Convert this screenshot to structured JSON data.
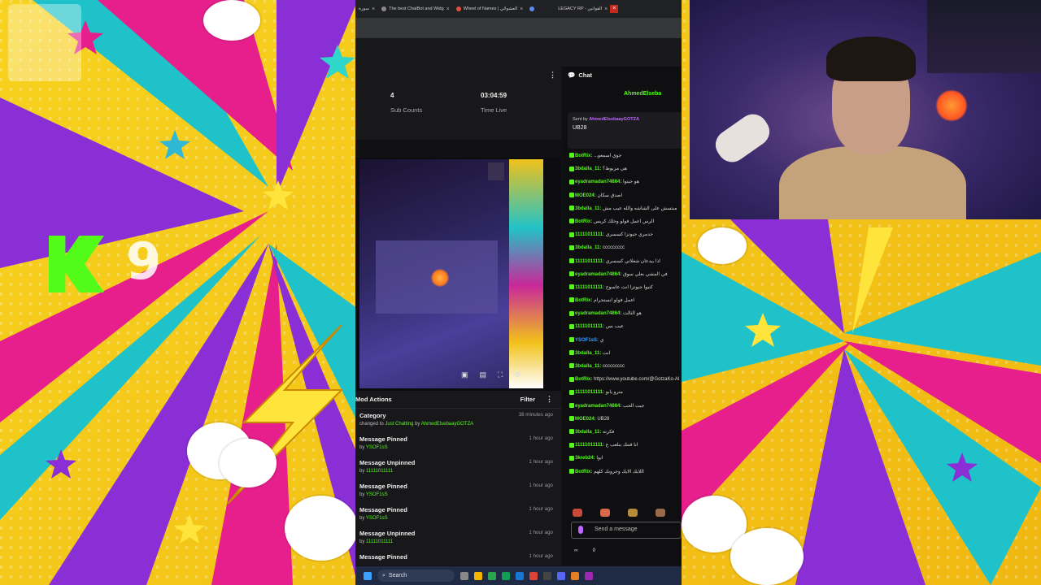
{
  "browser": {
    "tabs": [
      {
        "label": "سورة"
      },
      {
        "label": "The best ChatBot and Widg"
      },
      {
        "label": "Wheel of Names | العشوائي"
      },
      {
        "label": ""
      },
      {
        "label": "LEGACY RP - القوانين"
      }
    ],
    "close_glyph": "×"
  },
  "overlay": {
    "kick_count": "9"
  },
  "dashboard": {
    "stats": [
      {
        "value": "4",
        "label": "Sub Counts"
      },
      {
        "value": "03:04:59",
        "label": "Time Live"
      }
    ],
    "kebab_glyph": "⋮"
  },
  "player": {
    "controls": [
      "▣",
      "▤",
      "⛶",
      "⚙"
    ]
  },
  "mod_actions": {
    "title": "Mod Actions",
    "filter_label": "Filter",
    "items": [
      {
        "title": "Category",
        "by_prefix": "changed to",
        "target": "Just Chatting",
        "by_word": "by",
        "user": "AhmedElsebaayGOTZA",
        "time": "38 minutes ago"
      },
      {
        "title": "Message Pinned",
        "by_prefix": "by",
        "target": "",
        "by_word": "",
        "user": "YSOF1sS",
        "time": "1 hour ago"
      },
      {
        "title": "Message Unpinned",
        "by_prefix": "by",
        "target": "",
        "by_word": "",
        "user": "11111011111",
        "time": "1 hour ago"
      },
      {
        "title": "Message Pinned",
        "by_prefix": "by",
        "target": "",
        "by_word": "",
        "user": "YSOF1sS",
        "time": "1 hour ago"
      },
      {
        "title": "Message Pinned",
        "by_prefix": "by",
        "target": "",
        "by_word": "",
        "user": "YSOF1sS",
        "time": "1 hour ago"
      },
      {
        "title": "Message Unpinned",
        "by_prefix": "by",
        "target": "",
        "by_word": "",
        "user": "11111011111",
        "time": "1 hour ago"
      },
      {
        "title": "Message Pinned",
        "by_prefix": "",
        "target": "",
        "by_word": "",
        "user": "",
        "time": "1 hour ago"
      }
    ]
  },
  "chat": {
    "title": "Chat",
    "user": "AhmedElseba",
    "pinned": {
      "sent_by": "Sent by",
      "sender": "AhmedElsebaayGOTZA",
      "message": "UB28"
    },
    "messages": [
      {
        "name": "BotRix:",
        "color": "#53fc18",
        "text": "...جوي اسمعو"
      },
      {
        "name": "3bdalla_11:",
        "color": "#53fc18",
        "text": "هي مزبوط؟"
      },
      {
        "name": "eyadramadan74864:",
        "color": "#53fc18",
        "text": "هو جيتوا"
      },
      {
        "name": "MOE024:",
        "color": "#53fc18",
        "text": "اصدق سكان"
      },
      {
        "name": "3bdalla_11:",
        "color": "#53fc18",
        "text": "مبتسش على الشاشه والله عيب مش"
      },
      {
        "name": "BotRix:",
        "color": "#53fc18",
        "text": "الرس اعمل فولو وحلك كريس"
      },
      {
        "name": "11111011111:",
        "color": "#53fc18",
        "text": "خدمري جيوتزا كسسري"
      },
      {
        "name": "3bdalla_11:",
        "color": "#53fc18",
        "text": "ccccccccc"
      },
      {
        "name": "11111011111:",
        "color": "#53fc18",
        "text": "اذا بيدعان شغلاتي كسسري"
      },
      {
        "name": "eyadramadan74864:",
        "color": "#53fc18",
        "text": "في المشي بعلي سوق"
      },
      {
        "name": "11111011111:",
        "color": "#53fc18",
        "text": "كتيوا جيوتزا انت عاسوج"
      },
      {
        "name": "BotRix:",
        "color": "#53fc18",
        "text": "اعمل فولو انستجرام"
      },
      {
        "name": "eyadramadan74864:",
        "color": "#53fc18",
        "text": "هو الثالث"
      },
      {
        "name": "11111011111:",
        "color": "#53fc18",
        "text": "عيب بس"
      },
      {
        "name": "YSOF1sS:",
        "color": "#3aa0ff",
        "text": "ي"
      },
      {
        "name": "3bdalla_11:",
        "color": "#53fc18",
        "text": "انت"
      },
      {
        "name": "3bdalla_11:",
        "color": "#53fc18",
        "text": "ccccccccc"
      },
      {
        "name": "BotRix:",
        "color": "#53fc18",
        "text": "https://www.youtube.com/@GotzaKo-Al"
      },
      {
        "name": "11111011111:",
        "color": "#53fc18",
        "text": "مترو يابو"
      },
      {
        "name": "eyadramadan74864:",
        "color": "#53fc18",
        "text": "جيت الحب"
      },
      {
        "name": "MOE024:",
        "color": "#53fc18",
        "text": "UB28"
      },
      {
        "name": "3bdalla_11:",
        "color": "#53fc18",
        "text": "فكرته"
      },
      {
        "name": "11111011111:",
        "color": "#53fc18",
        "text": "انا قتتك بتلعب ع"
      },
      {
        "name": "3kreb24:",
        "color": "#53fc18",
        "text": "ابوا"
      },
      {
        "name": "BotRix:",
        "color": "#53fc18",
        "text": "اللايك الايك وجروبك كلهم"
      }
    ],
    "input_placeholder": "Send a message",
    "footer": {
      "infinity": "∞",
      "count": "0"
    }
  },
  "taskbar": {
    "search_label": "Search"
  }
}
